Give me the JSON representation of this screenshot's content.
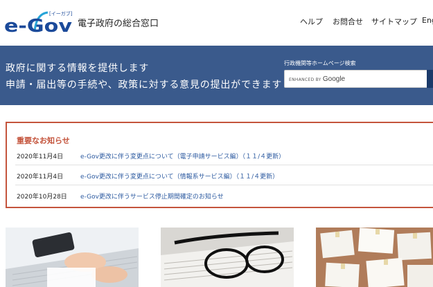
{
  "header": {
    "logo_text": "e-Gov",
    "logo_kana": "[イーガブ]",
    "subtitle": "電子政府の総合窓口",
    "nav": [
      "ヘルプ",
      "お問合せ",
      "サイトマップ",
      "English"
    ]
  },
  "banner": {
    "line1": "政府に関する情報を提供します",
    "line2": "申請・届出等の手続や、政策に対する意見の提出ができます",
    "search_label": "行政機関等ホームページ検索",
    "search_enhanced": "ENHANCED BY",
    "search_brand": "Google"
  },
  "notice": {
    "title": "重要なお知らせ",
    "items": [
      {
        "date": "2020年11月4日",
        "text": "e-Gov更改に伴う変更点について（電子申請サービス編）（１１/４更新）"
      },
      {
        "date": "2020年11月4日",
        "text": "e-Gov更改に伴う変更点について（情報系サービス編）（１１/４更新）"
      },
      {
        "date": "2020年10月28日",
        "text": "e-Gov更改に伴うサービス停止期間確定のお知らせ"
      }
    ]
  },
  "colors": {
    "banner": "#3a5a8c",
    "notice_border": "#c4543c",
    "link": "#2c5aa0",
    "logo_blue": "#1b4a9a"
  }
}
